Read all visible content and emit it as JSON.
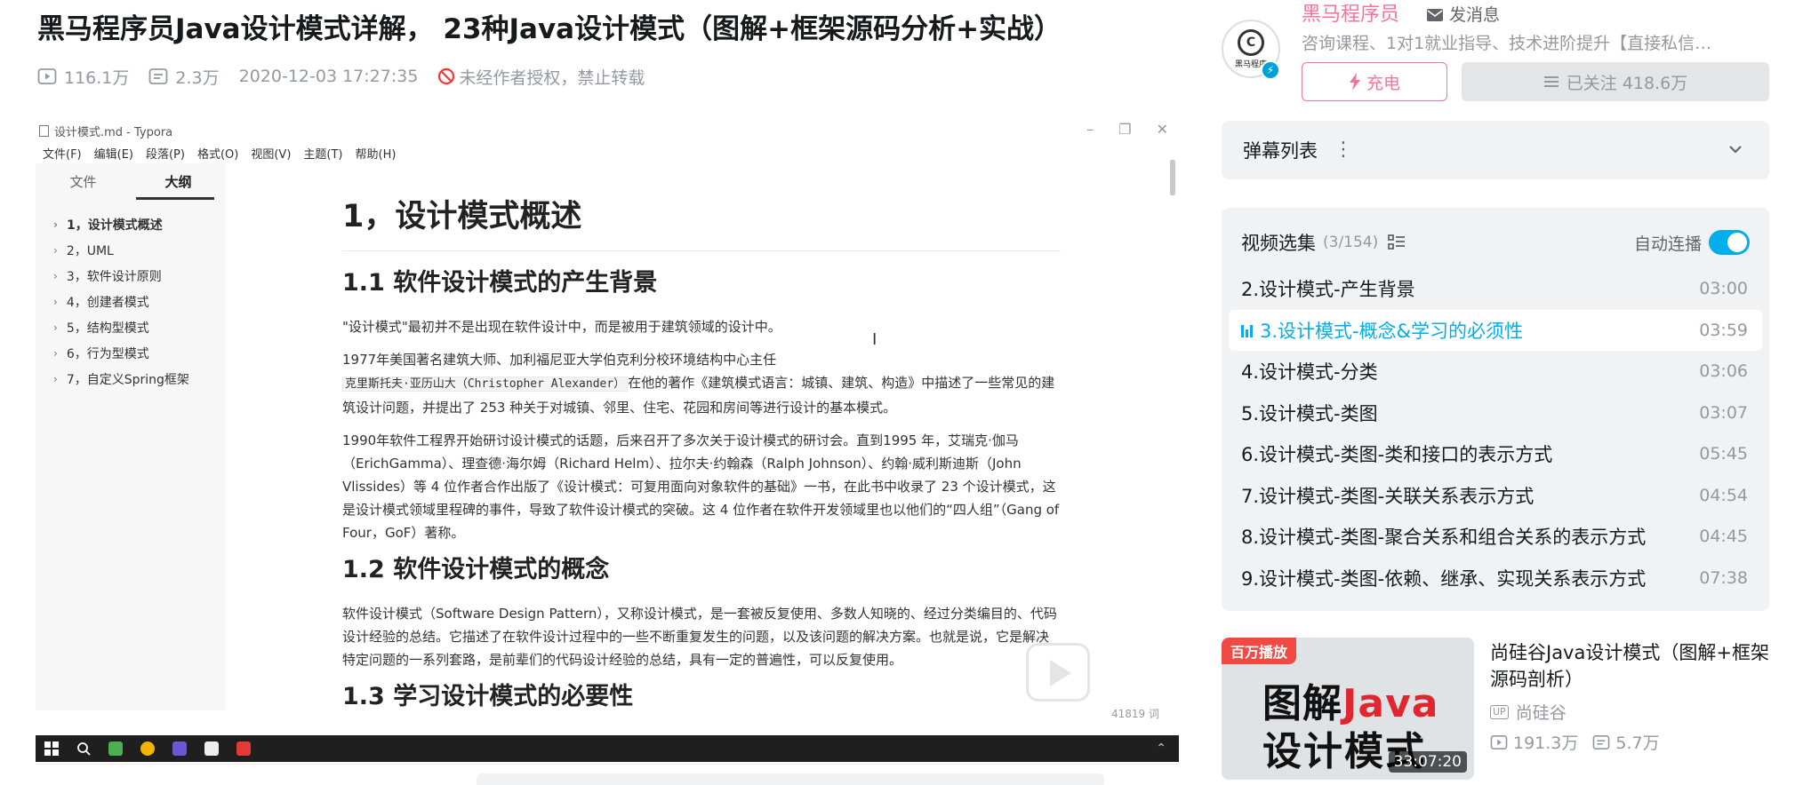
{
  "video": {
    "title": "黑马程序员Java设计模式详解， 23种Java设计模式（图解+框架源码分析+实战）",
    "views": "116.1万",
    "danmaku_count": "2.3万",
    "publish_time": "2020-12-03 17:27:35",
    "copyright_notice": "未经作者授权，禁止转载"
  },
  "player": {
    "window_title": "设计模式.md - Typora",
    "menu": [
      "文件(F)",
      "编辑(E)",
      "段落(P)",
      "格式(O)",
      "视图(V)",
      "主题(T)",
      "帮助(H)"
    ],
    "sidebar_tabs": [
      "文件",
      "大纲"
    ],
    "outline": [
      "1，设计模式概述",
      "2，UML",
      "3，软件设计原则",
      "4，创建者模式",
      "5，结构型模式",
      "6，行为型模式",
      "7，自定义Spring框架"
    ],
    "doc": {
      "h1": "1，设计模式概述",
      "h2_1": "1.1 软件设计模式的产生背景",
      "p1": "\"设计模式\"最初并不是出现在软件设计中，而是被用于建筑领域的设计中。",
      "p2_a": "1977年美国著名建筑大师、加利福尼亚大学伯克利分校环境结构中心主任",
      "p2_code": "克里斯托夫·亚历山大（Christopher Alexander）",
      "p2_b": "在他的著作《建筑模式语言：城镇、建筑、构造》中描述了一些常见的建筑设计问题，并提出了 253 种关于对城镇、邻里、住宅、花园和房间等进行设计的基本模式。",
      "p3": "1990年软件工程界开始研讨设计模式的话题，后来召开了多次关于设计模式的研讨会。直到1995 年，艾瑞克·伽马（ErichGamma）、理查德·海尔姆（Richard Helm）、拉尔夫·约翰森（Ralph Johnson）、约翰·威利斯迪斯（John Vlissides）等 4 位作者合作出版了《设计模式：可复用面向对象软件的基础》一书，在此书中收录了 23 个设计模式，这是设计模式领域里程碑的事件，导致了软件设计模式的突破。这 4 位作者在软件开发领域里也以他们的“四人组”（Gang of Four，GoF）著称。",
      "h2_2": "1.2 软件设计模式的概念",
      "p4": "软件设计模式（Software Design Pattern），又称设计模式，是一套被反复使用、多数人知晓的、经过分类编目的、代码设计经验的总结。它描述了在软件设计过程中的一些不断重复发生的问题，以及该问题的解决方案。也就是说，它是解决特定问题的一系列套路，是前辈们的代码设计经验的总结，具有一定的普遍性，可以反复使用。",
      "h2_3": "1.3 学习设计模式的必要性"
    },
    "word_count": "41819 词"
  },
  "uploader": {
    "name": "黑马程序员",
    "avatar_text": "黑马程序",
    "send_message": "发消息",
    "description": "咨询课程、1对1就业指导、技术进阶提升【直接私信…",
    "charge_label": "充电",
    "follow_label": "已关注 418.6万"
  },
  "danmaku_list": {
    "label": "弹幕列表"
  },
  "playlist": {
    "title": "视频选集",
    "count": "(3/154)",
    "autoplay_label": "自动连播",
    "items": [
      {
        "title": "2.设计模式-产生背景",
        "duration": "03:00"
      },
      {
        "title": "3.设计模式-概念&学习的必须性",
        "duration": "03:59"
      },
      {
        "title": "4.设计模式-分类",
        "duration": "03:06"
      },
      {
        "title": "5.设计模式-类图",
        "duration": "03:07"
      },
      {
        "title": "6.设计模式-类图-类和接口的表示方式",
        "duration": "05:45"
      },
      {
        "title": "7.设计模式-类图-关联关系表示方式",
        "duration": "04:54"
      },
      {
        "title": "8.设计模式-类图-聚合关系和组合关系的表示方式",
        "duration": "04:45"
      },
      {
        "title": "9.设计模式-类图-依赖、继承、实现关系表示方式",
        "duration": "07:38"
      }
    ]
  },
  "recommendation": {
    "badge": "百万播放",
    "thumb_line1_a": "图解",
    "thumb_line1_b": "Java",
    "thumb_line2": "设计模式",
    "duration": "33:07:20",
    "title": "尚硅谷Java设计模式（图解+框架源码剖析）",
    "up_tag": "UP",
    "up_name": "尚硅谷",
    "views": "191.3万",
    "danmaku": "5.7万"
  },
  "colors": {
    "accent_blue": "#00aeec",
    "brand_pink": "#fb7299",
    "muted_text": "#9499a0"
  }
}
